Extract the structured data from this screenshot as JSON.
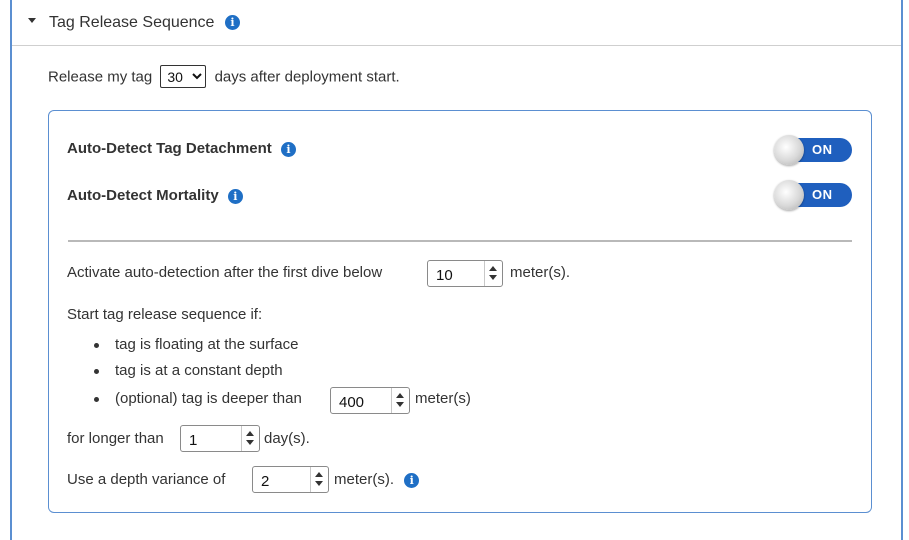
{
  "section": {
    "title": "Tag Release Sequence"
  },
  "release": {
    "prefix": "Release my tag",
    "days_selected": "30",
    "suffix": "days after deployment start."
  },
  "detection": {
    "tag_detachment_label": "Auto-Detect Tag Detachment",
    "tag_detachment_toggle": "ON",
    "mortality_label": "Auto-Detect Mortality",
    "mortality_toggle": "ON"
  },
  "activation": {
    "prefix": "Activate auto-detection after the first dive below",
    "depth_value": "10",
    "unit": "meter(s)."
  },
  "conditions": {
    "intro": "Start tag release sequence if:",
    "items": [
      "tag is floating at the surface",
      "tag is at a constant depth",
      "(optional) tag is deeper than"
    ],
    "optional_depth_value": "400",
    "optional_unit": "meter(s)"
  },
  "duration": {
    "prefix": "for longer than",
    "value": "1",
    "unit": "day(s)."
  },
  "variance": {
    "prefix": "Use a depth variance of",
    "value": "2",
    "unit": "meter(s)."
  },
  "colors": {
    "accent": "#1f5fbe",
    "info_icon": "#1f6fc5",
    "panel_border": "#5b8fd1"
  },
  "icons": {
    "info": "info-icon",
    "caret": "caret-down-icon"
  }
}
